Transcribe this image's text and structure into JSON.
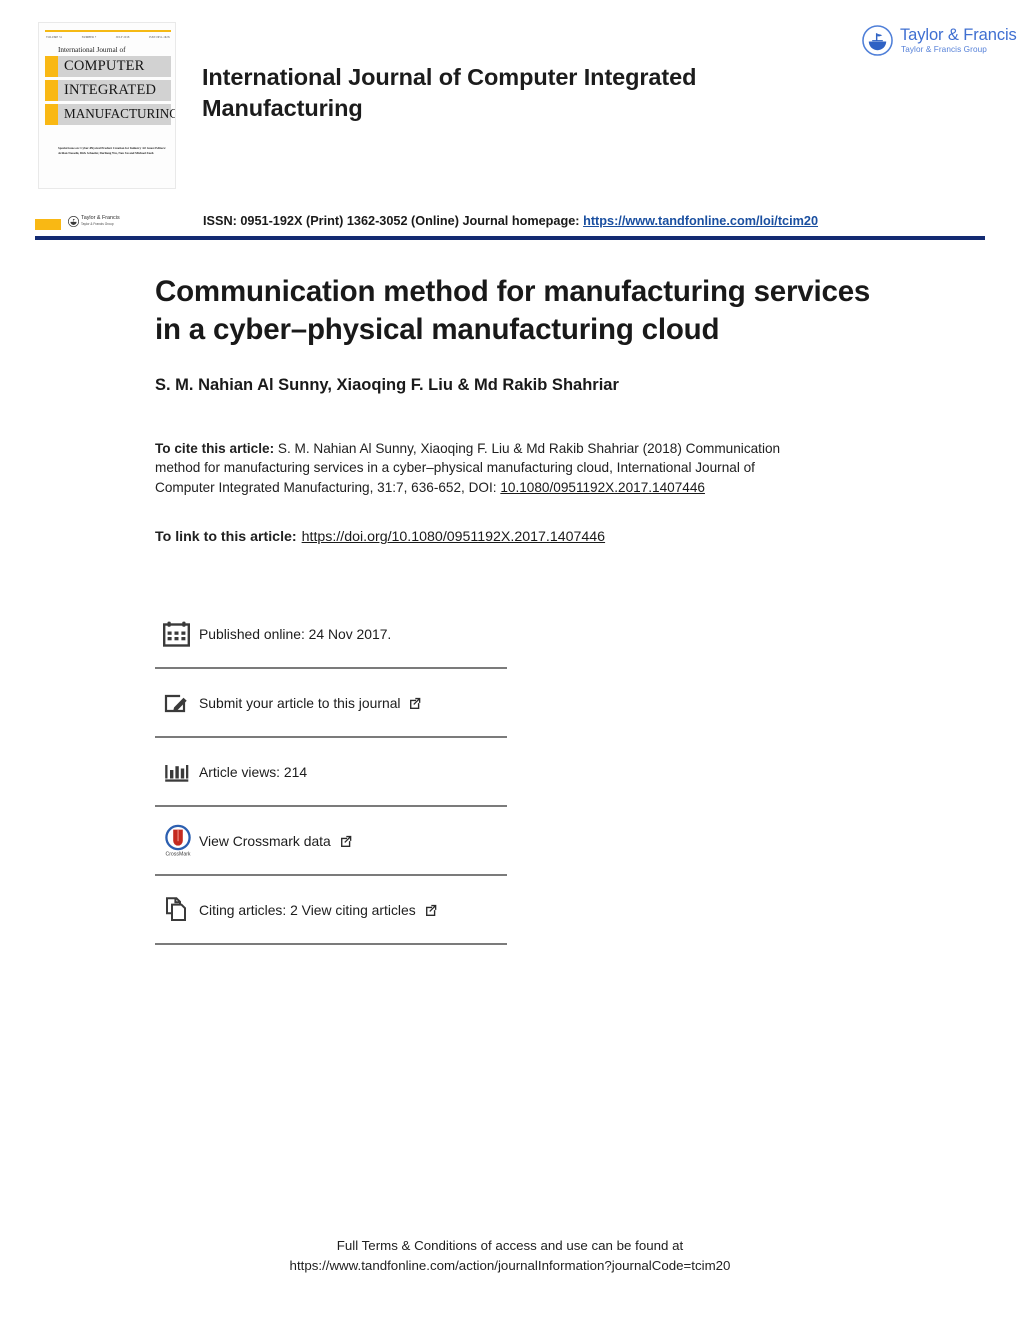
{
  "header": {
    "journal_title": "International Journal of Computer Integrated Manufacturing",
    "cover": {
      "issue_volume": "VOLUME 31",
      "issue_number": "NUMBER 7",
      "issue_date": "JULY 2018",
      "issue_issn": "ISSN 0951-192X",
      "kicker": "International Journal of",
      "band1": "COMPUTER",
      "band2": "INTEGRATED",
      "band3": "MANUFACTURING",
      "special_issue": "Special issue on: Cyber-Physical Product Creation for Industry 4.0 Guest Editors: Ardian Nassehi, Dirk Schaefer, Darliang Wu, Nan Xu and Michael Zueh"
    },
    "publisher": {
      "name": "Taylor & Francis",
      "group": "Taylor & Francis Group",
      "brand_color": "#3f6fd1"
    },
    "issn_line_prefix": "ISSN: 0951-192X (Print) 1362-3052 (Online) Journal homepage:",
    "journal_homepage_url": "https://www.tandfonline.com/loi/tcim20",
    "rule_color": "#132a72"
  },
  "article": {
    "title": "Communication method for manufacturing services in a cyber–physical manufacturing cloud",
    "authors": "S. M. Nahian Al Sunny, Xiaoqing F. Liu & Md Rakib Shahriar",
    "cite": {
      "lead": "To cite this article:",
      "text": " S. M. Nahian Al Sunny, Xiaoqing F. Liu & Md Rakib Shahriar (2018) Communication method for manufacturing services in a cyber–physical manufacturing cloud, International Journal of Computer Integrated Manufacturing, 31:7, 636-652, DOI:",
      "doi": "10.1080/0951192X.2017.1407446"
    },
    "link": {
      "lead": "To link to this article:",
      "url": "https://doi.org/10.1080/0951192X.2017.1407446"
    }
  },
  "meta_rows": [
    {
      "icon": "calendar-icon",
      "label": "Published online: 24 Nov 2017.",
      "external": false
    },
    {
      "icon": "submit-article-icon",
      "label": "Submit your article to this journal",
      "external": true
    },
    {
      "icon": "article-views-icon",
      "label": "Article views: 214",
      "external": false
    },
    {
      "icon": "crossmark-icon",
      "label": "View Crossmark data",
      "external": true
    },
    {
      "icon": "citing-articles-icon",
      "label": "Citing articles: 2 View citing articles",
      "external": true
    }
  ],
  "footer": {
    "line1": "Full Terms & Conditions of access and use can be found at",
    "line2": "https://www.tandfonline.com/action/journalInformation?journalCode=tcim20"
  }
}
